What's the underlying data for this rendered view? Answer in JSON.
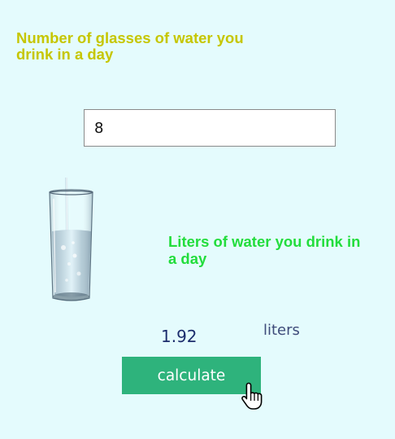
{
  "form": {
    "question_label": "Number of glasses of water you drink in a day",
    "glasses_value": "8",
    "result_label": "Liters of water you drink in a day",
    "result_value": "1.92",
    "result_unit": "liters",
    "calculate_label": "calculate"
  },
  "icons": {
    "glass": "water-glass-icon",
    "cursor": "hand-pointer-icon"
  },
  "colors": {
    "background": "#e4fbfd",
    "question_label": "#c6c600",
    "result_label": "#22dd3c",
    "result_value": "#1c2d6d",
    "button": "#2eb37c"
  }
}
